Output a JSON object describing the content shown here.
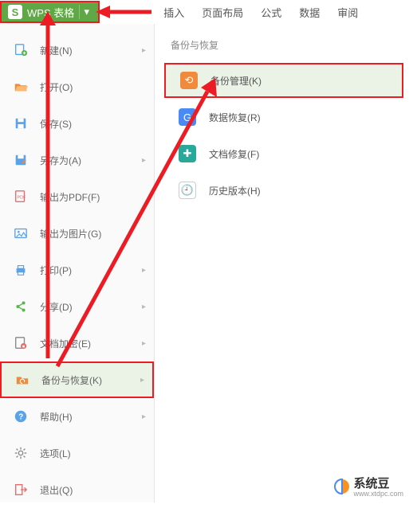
{
  "app": {
    "name": "WPS 表格"
  },
  "tabs": [
    "插入",
    "页面布局",
    "公式",
    "数据",
    "审阅"
  ],
  "menu": [
    {
      "icon": "new",
      "label": "新建(N)",
      "chevron": true,
      "color": "#5aa3e8"
    },
    {
      "icon": "open",
      "label": "打开(O)",
      "chevron": false,
      "color": "#f08a3c"
    },
    {
      "icon": "save",
      "label": "保存(S)",
      "chevron": false,
      "color": "#5aa3e8"
    },
    {
      "icon": "saveas",
      "label": "另存为(A)",
      "chevron": true,
      "color": "#5aa3e8"
    },
    {
      "icon": "pdf",
      "label": "输出为PDF(F)",
      "chevron": false,
      "color": "#e86b6b"
    },
    {
      "icon": "image",
      "label": "输出为图片(G)",
      "chevron": false,
      "color": "#5aa3e8"
    },
    {
      "icon": "print",
      "label": "打印(P)",
      "chevron": true,
      "color": "#5aa3e8"
    },
    {
      "icon": "share",
      "label": "分享(D)",
      "chevron": true,
      "color": "#55b848"
    },
    {
      "icon": "encrypt",
      "label": "文档加密(E)",
      "chevron": true,
      "color": "#e86b6b"
    },
    {
      "icon": "backup",
      "label": "备份与恢复(K)",
      "chevron": true,
      "color": "#f08a3c",
      "active": true
    },
    {
      "icon": "help",
      "label": "帮助(H)",
      "chevron": true,
      "color": "#5aa3e8"
    },
    {
      "icon": "options",
      "label": "选项(L)",
      "chevron": false,
      "color": "#888"
    },
    {
      "icon": "exit",
      "label": "退出(Q)",
      "chevron": false,
      "color": "#e86b6b"
    }
  ],
  "panel": {
    "title": "备份与恢复",
    "items": [
      {
        "label": "备份管理(K)",
        "bg": "#f08a3c",
        "highlight": true
      },
      {
        "label": "数据恢复(R)",
        "bg": "#4a8af4",
        "highlight": false
      },
      {
        "label": "文档修复(F)",
        "bg": "#2aa89a",
        "highlight": false
      },
      {
        "label": "历史版本(H)",
        "bg": "#ffffff",
        "highlight": false,
        "border": true
      }
    ]
  },
  "watermark": {
    "main": "系统豆",
    "sub": "www.xtdpc.com"
  }
}
